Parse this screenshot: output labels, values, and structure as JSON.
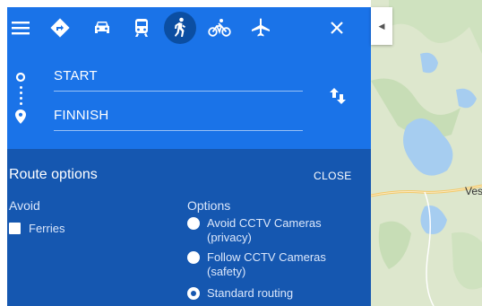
{
  "modes": [
    {
      "icon": "menu-icon"
    },
    {
      "icon": "directions-icon"
    },
    {
      "icon": "car-icon"
    },
    {
      "icon": "transit-icon"
    },
    {
      "icon": "walking-icon",
      "active": true
    },
    {
      "icon": "cycling-icon"
    },
    {
      "icon": "flight-icon"
    },
    {
      "icon": "close-icon"
    }
  ],
  "route": {
    "start": "START",
    "end": "FINNISH"
  },
  "route_options": {
    "title": "Route options",
    "close_label": "CLOSE",
    "avoid_heading": "Avoid",
    "avoid_items": [
      {
        "label": "Ferries",
        "checked": false
      }
    ],
    "options_heading": "Options",
    "options": [
      {
        "label": "Avoid CCTV Cameras (privacy)",
        "checked": false
      },
      {
        "label": "Follow CCTV Cameras (safety)",
        "checked": false
      },
      {
        "label": "Standard routing",
        "checked": true
      }
    ]
  },
  "map": {
    "place_label": "Ves"
  },
  "colors": {
    "panel_blue": "#1a73e8",
    "options_blue": "#1557b0",
    "active_mode": "#0b4ea2"
  }
}
